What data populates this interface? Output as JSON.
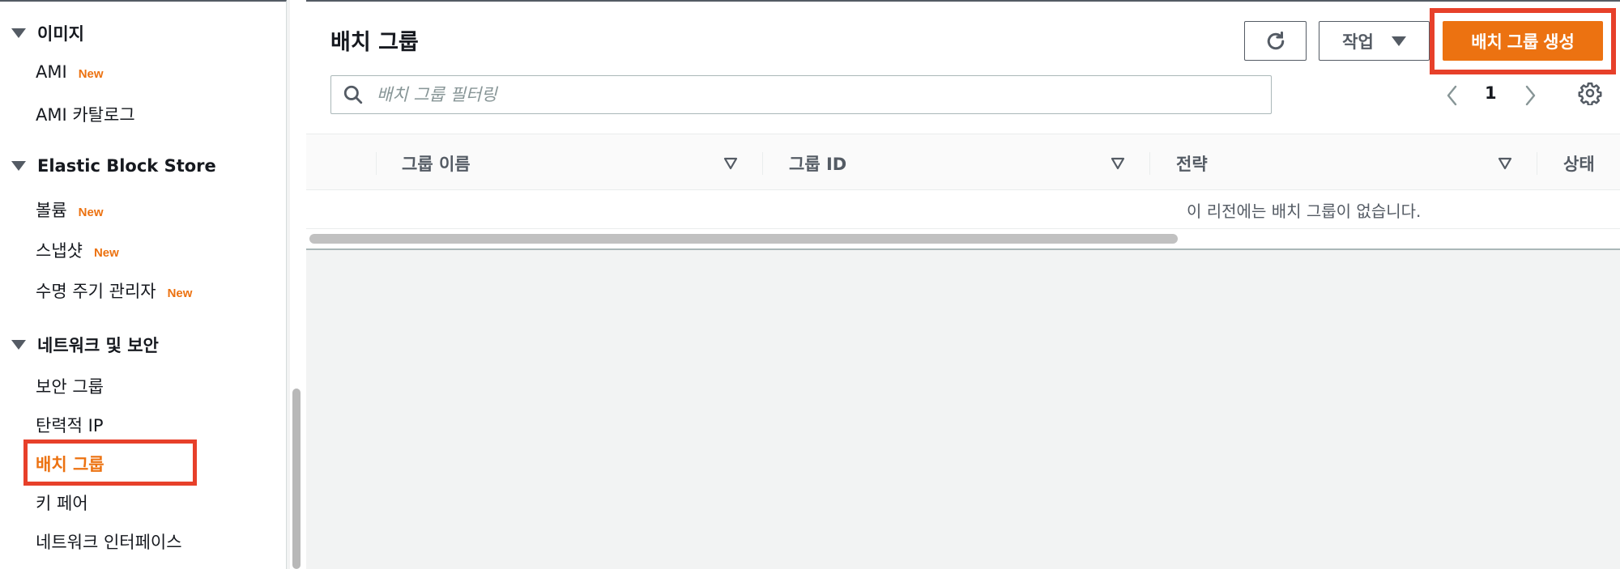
{
  "sidebar": {
    "sections": [
      {
        "title": "이미지",
        "items": [
          {
            "label": "AMI",
            "badge": "New"
          },
          {
            "label": "AMI 카탈로그"
          }
        ]
      },
      {
        "title": "Elastic Block Store",
        "items": [
          {
            "label": "볼륨",
            "badge": "New"
          },
          {
            "label": "스냅샷",
            "badge": "New"
          },
          {
            "label": "수명 주기 관리자",
            "badge": "New"
          }
        ]
      },
      {
        "title": "네트워크 및 보안",
        "items": [
          {
            "label": "보안 그룹"
          },
          {
            "label": "탄력적 IP"
          },
          {
            "label": "배치 그룹",
            "active": true
          },
          {
            "label": "키 페어"
          },
          {
            "label": "네트워크 인터페이스"
          }
        ]
      }
    ]
  },
  "header": {
    "title": "배치 그룹",
    "actions_label": "작업",
    "create_label": "배치 그룹 생성"
  },
  "search": {
    "placeholder": "배치 그룹 필터링"
  },
  "pagination": {
    "current_page": "1"
  },
  "table": {
    "columns": [
      "그룹 이름",
      "그룹 ID",
      "전략",
      "상태"
    ],
    "empty_message": "이 리전에는 배치 그룹이 없습니다."
  },
  "colors": {
    "accent": "#ec7211",
    "highlight": "#e7402a",
    "text_secondary": "#545b64"
  },
  "icons": [
    "caret-down-icon",
    "refresh-icon",
    "search-icon",
    "chevron-left-icon",
    "chevron-right-icon",
    "gear-icon",
    "sort-icon"
  ]
}
